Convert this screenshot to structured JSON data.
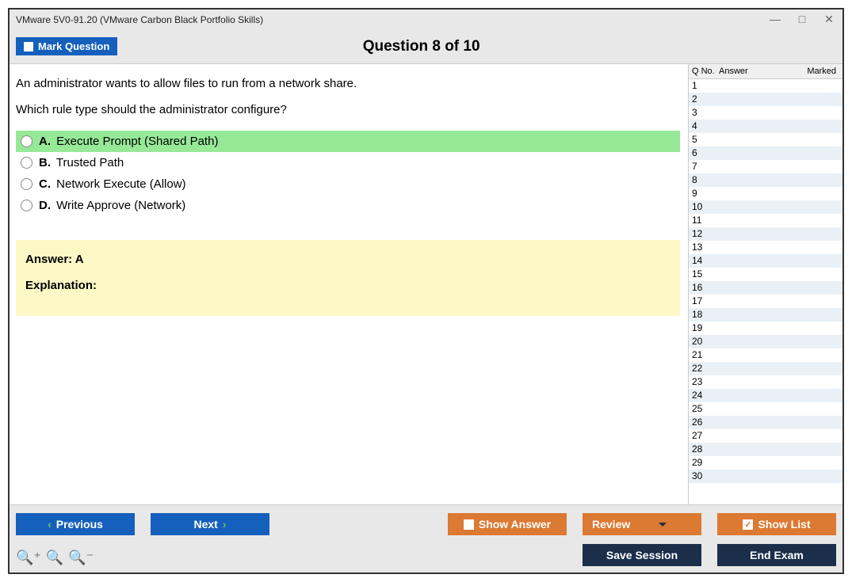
{
  "titlebar": {
    "title": "VMware 5V0-91.20 (VMware Carbon Black Portfolio Skills)"
  },
  "header": {
    "mark_label": "Mark Question",
    "question_title": "Question 8 of 10"
  },
  "question": {
    "line1": "An administrator wants to allow files to run from a network share.",
    "line2": "Which rule type should the administrator configure?"
  },
  "options": [
    {
      "letter": "A.",
      "text": "Execute Prompt (Shared Path)",
      "highlight": true
    },
    {
      "letter": "B.",
      "text": "Trusted Path",
      "highlight": false
    },
    {
      "letter": "C.",
      "text": "Network Execute (Allow)",
      "highlight": false
    },
    {
      "letter": "D.",
      "text": "Write Approve (Network)",
      "highlight": false
    }
  ],
  "answer_panel": {
    "answer": "Answer: A",
    "explanation_label": "Explanation:"
  },
  "sidebar": {
    "col_qno": "Q No.",
    "col_answer": "Answer",
    "col_marked": "Marked",
    "rows": [
      "1",
      "2",
      "3",
      "4",
      "5",
      "6",
      "7",
      "8",
      "9",
      "10",
      "11",
      "12",
      "13",
      "14",
      "15",
      "16",
      "17",
      "18",
      "19",
      "20",
      "21",
      "22",
      "23",
      "24",
      "25",
      "26",
      "27",
      "28",
      "29",
      "30"
    ]
  },
  "footer": {
    "previous": "Previous",
    "next": "Next",
    "show_answer": "Show Answer",
    "review": "Review",
    "show_list": "Show List",
    "save_session": "Save Session",
    "end_exam": "End Exam"
  }
}
